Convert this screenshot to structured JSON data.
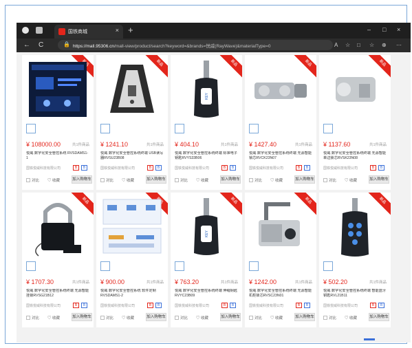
{
  "browser": {
    "tab_title": "国铁商城",
    "tab_close": "×",
    "new_tab": "+",
    "window_controls": [
      "–",
      "□",
      "×"
    ],
    "nav": [
      "←",
      "C"
    ],
    "url_host": "https://mall.95306.cn",
    "url_path": "/mall-view/product/search?keyword=&brands=悦威(RayWave)&materialType=0",
    "tools": [
      "A",
      "☆",
      "□",
      "☆",
      "⊕",
      "⋯"
    ]
  },
  "common": {
    "badge": "新品",
    "compare": "对比",
    "favorite": "♡ 收藏",
    "add_cart": "加入购物车",
    "shop": "国铁悦威科技有限公司",
    "count": "共1件商品",
    "tag_a": "B",
    "tag_b": "B"
  },
  "products": [
    {
      "price": "¥ 108000.00",
      "name": "悦威 数字化安全管控系统 RVSDAMS1-1",
      "image": "dark-screen"
    },
    {
      "price": "¥ 1241.10",
      "name": "悦威 数字化安全管控系统终端 USB读写器RVSU23B08",
      "image": "reader"
    },
    {
      "price": "¥ 404.10",
      "name": "悦威 数字化安全管控系统终端 标准电子钥匙RVYS33B06",
      "image": "key"
    },
    {
      "price": "¥ 1427.40",
      "name": "悦威 数字化安全管控系统终端 无源智能锁芯RVCK23N07",
      "image": "cylinder"
    },
    {
      "price": "¥ 1137.60",
      "name": "悦威 数字化安全管控系统终端 无源智能单边锁芯RVSK23N08",
      "image": "half-cylinder"
    },
    {
      "price": "¥ 1707.30",
      "name": "悦威 数字化安全管控系统终端 无源智能挂锁RVSG21B12",
      "image": "padlock"
    },
    {
      "price": "¥ 900.00",
      "name": "悦威 数字化安全管控系统 软件定制RVSDAMS1-2",
      "image": "diagram"
    },
    {
      "price": "¥ 763.20",
      "name": "悦威 数字化安全管控系统终端 伸缩钥匙RVYC23B09",
      "image": "key"
    },
    {
      "price": "¥ 1242.00",
      "name": "悦威 数字化安全管控系统终端 无源智能机柜锁芯RVSC23N01",
      "image": "cabinet-lock"
    },
    {
      "price": "¥ 502.20",
      "name": "悦威 数字化安全管控系统终端 智能蓝牙钥匙RVL21B11",
      "image": "bt-key"
    }
  ],
  "colors": {
    "accent": "#e3251b",
    "blue": "#3a6fd8"
  }
}
